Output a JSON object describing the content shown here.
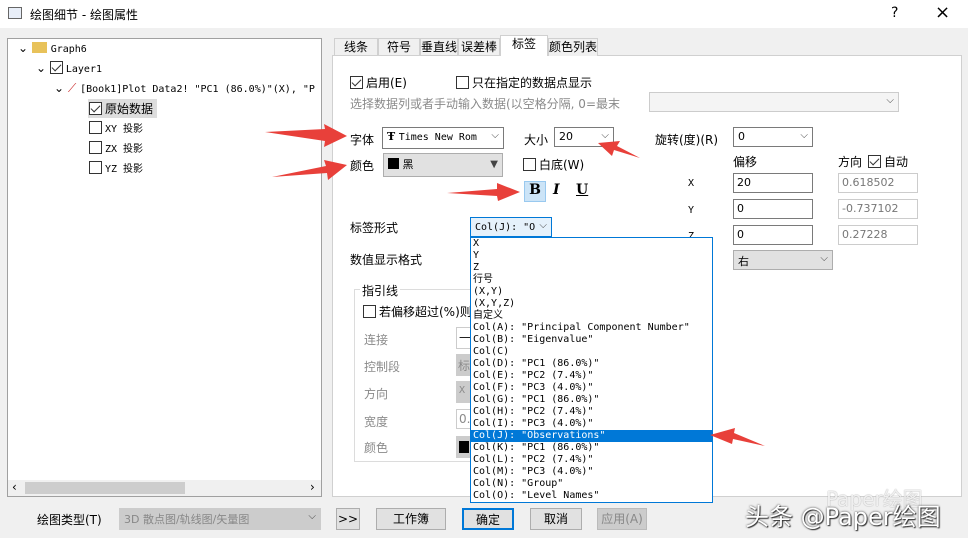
{
  "window": {
    "title": "绘图细节 - 绘图属性",
    "help": "?",
    "close": "×"
  },
  "tree": {
    "items": [
      "Graph6",
      "Layer1",
      "[Book1]Plot Data2! \"PC1 (86.0%)\"(X), \"P",
      "原始数据",
      "XY 投影",
      "ZX 投影",
      "YZ 投影"
    ]
  },
  "tabs": [
    "线条",
    "符号",
    "垂直线",
    "误差棒",
    "标签",
    "颜色列表"
  ],
  "labels": {
    "enable": "启用(E)",
    "only_specified": "只在指定的数据点显示",
    "select_data": "选择数据列或者手动输入数据(以空格分隔, 0=最末",
    "font": "字体",
    "font_value": "Times New Rom",
    "size": "大小",
    "size_value": "20",
    "rotation": "旋转(度)(R)",
    "rotation_value": "0",
    "color": "颜色",
    "color_value": "黑",
    "white_bg": "白底(W)",
    "offset": "偏移",
    "direction": "方向",
    "auto": "自动",
    "bold": "B",
    "italic": "I",
    "underline": "U",
    "x": "X",
    "y": "Y",
    "z": "Z",
    "x_val": "20",
    "y_val": "0",
    "z_val": "0",
    "x_dir": "0.618502",
    "y_dir": "-0.737102",
    "z_dir": "0.27228",
    "label_form": "标签形式",
    "label_form_value": "Col(J): \"O",
    "num_format": "数值显示格式",
    "align_value": "右"
  },
  "leader": {
    "title": "指引线",
    "check": "若偏移超过(%)则",
    "connect": "连接",
    "control": "控制段",
    "direction": "方向",
    "width": "宽度",
    "color": "颜色",
    "control_val": "标",
    "dir_val": "X",
    "width_val": "0."
  },
  "dropdown": [
    "X",
    "Y",
    "Z",
    "行号",
    "(X,Y)",
    "(X,Y,Z)",
    "自定义",
    "Col(A): \"Principal Component Number\"",
    "Col(B): \"Eigenvalue\"",
    "Col(C)",
    "Col(D): \"PC1 (86.0%)\"",
    "Col(E): \"PC2 (7.4%)\"",
    "Col(F): \"PC3 (4.0%)\"",
    "Col(G): \"PC1 (86.0%)\"",
    "Col(H): \"PC2 (7.4%)\"",
    "Col(I): \"PC3 (4.0%)\"",
    "Col(J): \"Observations\"",
    "Col(K): \"PC1 (86.0%)\"",
    "Col(L): \"PC2 (7.4%)\"",
    "Col(M): \"PC3 (4.0%)\"",
    "Col(N): \"Group\"",
    "Col(O): \"Level Names\""
  ],
  "bottom": {
    "plot_type": "绘图类型(T)",
    "plot_type_value": "3D 散点图/轨线图/矢量图",
    "more": ">>",
    "workbook": "工作簿",
    "ok": "确定",
    "cancel": "取消",
    "apply": "应用(A)"
  },
  "watermark": {
    "top": "Paper绘图",
    "main": "头条 @Paper绘图"
  },
  "colors": {
    "accent": "#0078d7",
    "arrow": "#e8403a"
  }
}
